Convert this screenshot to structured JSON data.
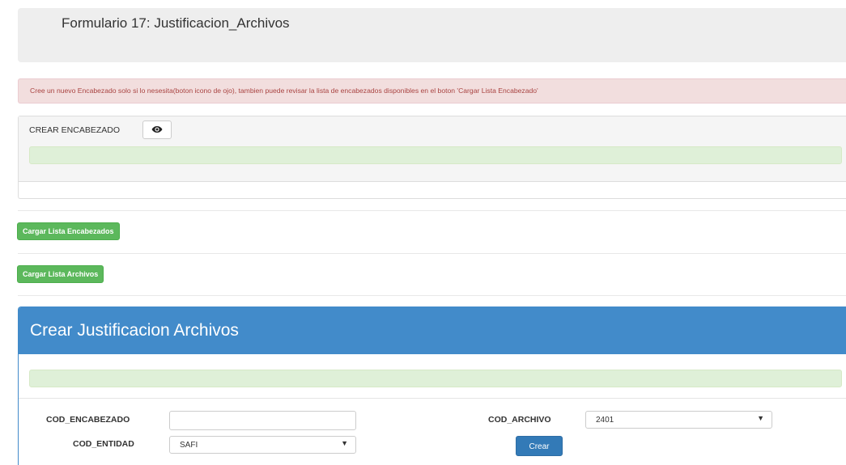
{
  "header": {
    "title": "Formulario 17: Justificacion_Archivos"
  },
  "alert": {
    "message": "Cree un nuevo Encabezado solo si lo nesesita(boton icono de ojo), tambien puede revisar la lista de encabezados disponibles en el boton 'Cargar Lista Encabezado'"
  },
  "crear_encabezado": {
    "label": "CREAR ENCABEZADO",
    "toggle_icon": "eye-icon"
  },
  "actions": {
    "load_headers_label": "Cargar Lista Encabezados",
    "load_files_label": "Cargar Lista Archivos"
  },
  "justificacion_panel": {
    "title": "Crear Justificacion Archivos",
    "cod_encabezado_label": "COD_ENCABEZADO",
    "cod_encabezado_value": "",
    "cod_archivo_label": "COD_ARCHIVO",
    "cod_archivo_value": "2401",
    "cod_entidad_label": "COD_ENTIDAD",
    "cod_entidad_value": "SAFI",
    "submit_label": "Crear"
  },
  "colors": {
    "primary": "#428bca",
    "success": "#5cb85c",
    "danger_text": "#a94442",
    "danger_bg": "#f2dede",
    "success_bg": "#dff0d8"
  }
}
